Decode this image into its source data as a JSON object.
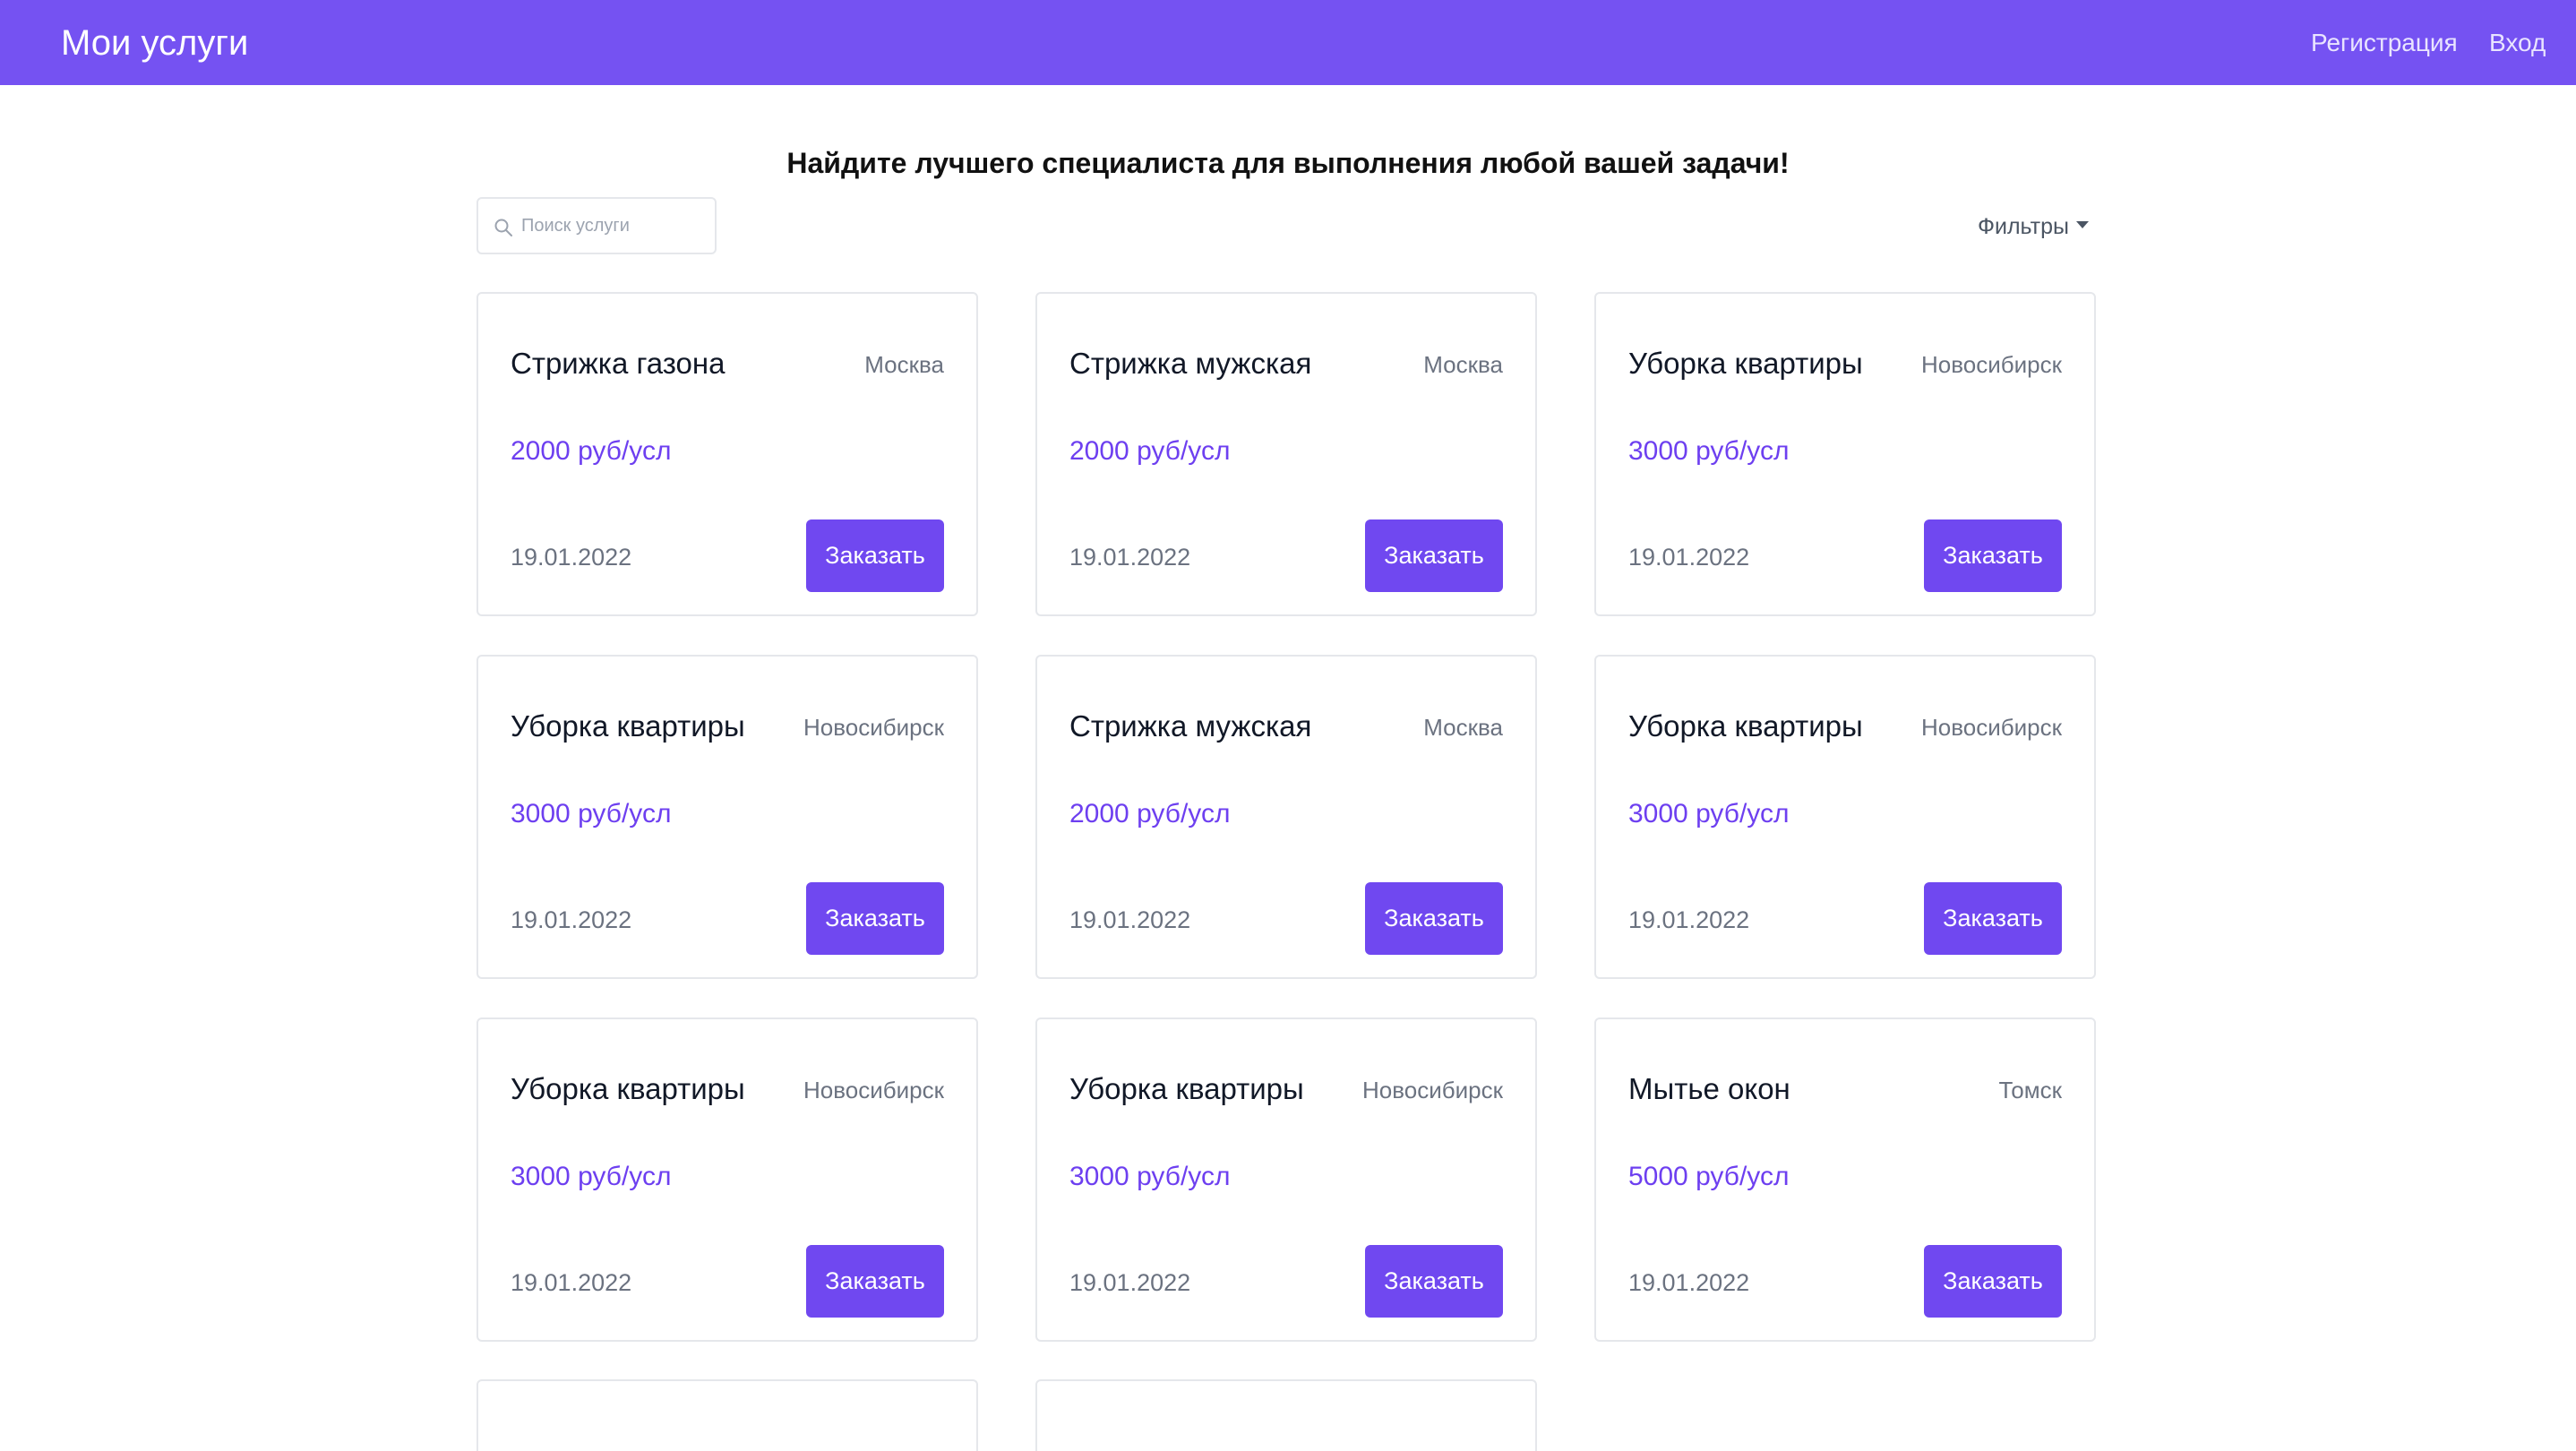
{
  "header": {
    "brand": "Мои услуги",
    "nav": {
      "register": "Регистрация",
      "login": "Вход"
    }
  },
  "main": {
    "headline": "Найдите лучшего специалиста для выполнения любой вашей задачи!",
    "search": {
      "placeholder": "Поиск услуги",
      "value": ""
    },
    "filters_label": "Фильтры",
    "cards": [
      {
        "title": "Стрижка газона",
        "city": "Москва",
        "price": "2000 руб/усл",
        "date": "19.01.2022",
        "button": "Заказать"
      },
      {
        "title": "Стрижка мужская",
        "city": "Москва",
        "price": "2000 руб/усл",
        "date": "19.01.2022",
        "button": "Заказать"
      },
      {
        "title": "Уборка квартиры",
        "city": "Новосибирск",
        "price": "3000 руб/усл",
        "date": "19.01.2022",
        "button": "Заказать"
      },
      {
        "title": "Уборка квартиры",
        "city": "Новосибирск",
        "price": "3000 руб/усл",
        "date": "19.01.2022",
        "button": "Заказать"
      },
      {
        "title": "Стрижка мужская",
        "city": "Москва",
        "price": "2000 руб/усл",
        "date": "19.01.2022",
        "button": "Заказать"
      },
      {
        "title": "Уборка квартиры",
        "city": "Новосибирск",
        "price": "3000 руб/усл",
        "date": "19.01.2022",
        "button": "Заказать"
      },
      {
        "title": "Уборка квартиры",
        "city": "Новосибирск",
        "price": "3000 руб/усл",
        "date": "19.01.2022",
        "button": "Заказать"
      },
      {
        "title": "Уборка квартиры",
        "city": "Новосибирск",
        "price": "3000 руб/усл",
        "date": "19.01.2022",
        "button": "Заказать"
      },
      {
        "title": "Мытье окон",
        "city": "Томск",
        "price": "5000 руб/усл",
        "date": "19.01.2022",
        "button": "Заказать"
      }
    ]
  },
  "colors": {
    "brand": "#7552f2",
    "button": "#7048f0",
    "price": "#6d3ff0"
  },
  "icons": {
    "search": "search-icon",
    "filters": "caret-down-icon"
  }
}
